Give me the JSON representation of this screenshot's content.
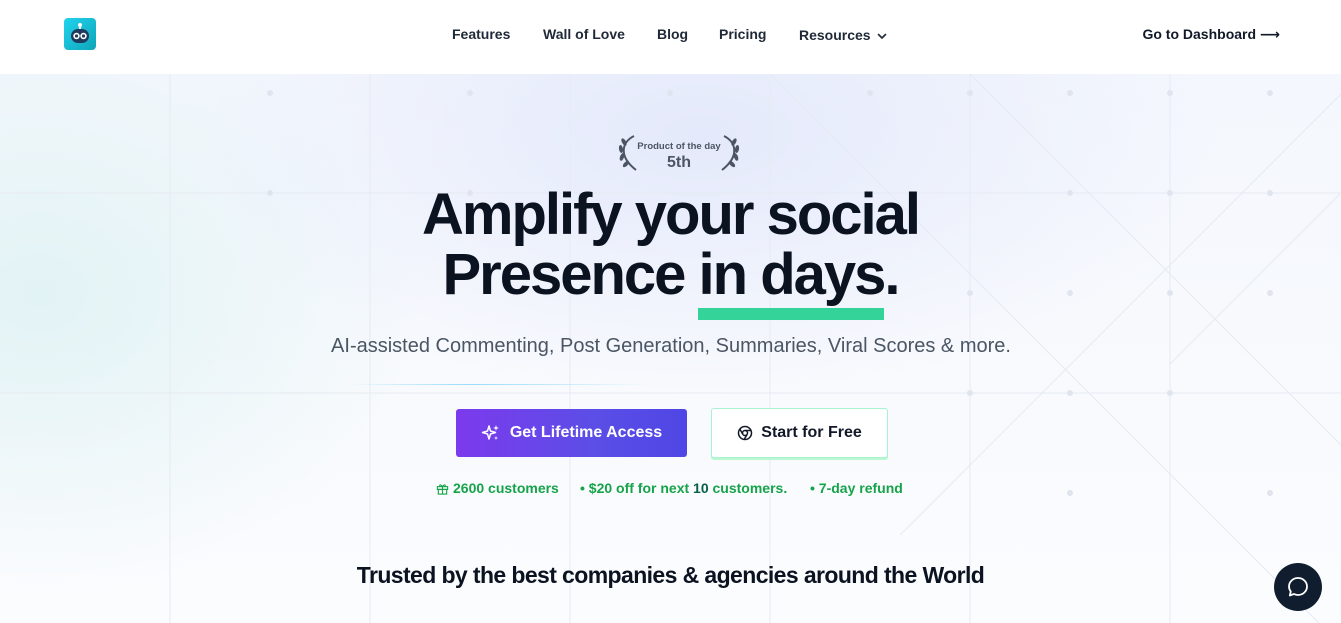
{
  "header": {
    "logo_icon": "robot-face-icon",
    "nav": [
      {
        "label": "Features"
      },
      {
        "label": "Wall of Love"
      },
      {
        "label": "Blog"
      },
      {
        "label": "Pricing"
      },
      {
        "label": "Resources",
        "icon": "chevron-down-icon"
      }
    ],
    "dashboard_link": "Go to Dashboard ⟶"
  },
  "hero": {
    "award": {
      "line1": "Product of the day",
      "line2": "5th",
      "icon": "laurel-wreath-icon"
    },
    "headline_line1": "Amplify your social",
    "headline_line2": "Presence in days.",
    "subtitle": "AI-assisted Commenting, Post Generation, Summaries, Viral Scores & more.",
    "cta_primary": {
      "label": "Get Lifetime Access",
      "icon": "sparkles-icon"
    },
    "cta_secondary": {
      "label": "Start for Free",
      "icon": "chrome-icon"
    },
    "stats": {
      "customers": "2600 customers",
      "discount_prefix": "• $20 off for next",
      "discount_count": "10",
      "discount_suffix": "customers.",
      "refund": "• 7-day refund"
    }
  },
  "trusted_heading": "Trusted by the best companies & agencies around the World",
  "chat_button": {
    "icon": "chat-bubble-icon"
  },
  "colors": {
    "accent_purple": "#7c3aed",
    "accent_indigo": "#4f46e5",
    "highlight_green": "#34d399",
    "stats_green": "#16a34a",
    "text_dark": "#0b1220"
  }
}
